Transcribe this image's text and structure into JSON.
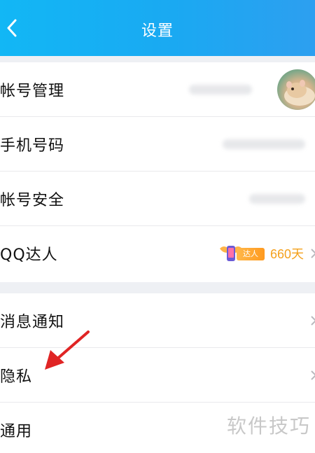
{
  "header": {
    "title": "设置",
    "back_icon": "chevron-left-icon"
  },
  "group1": {
    "rows": [
      {
        "label": "帐号管理"
      },
      {
        "label": "手机号码"
      },
      {
        "label": "帐号安全"
      },
      {
        "label": "QQ达人",
        "badge_text": "达人",
        "days": "660天"
      }
    ]
  },
  "group2": {
    "rows": [
      {
        "label": "消息通知"
      },
      {
        "label": "隐私"
      },
      {
        "label": "通用"
      }
    ]
  },
  "watermark": "软件技巧",
  "colors": {
    "header": "#12b7f5",
    "days": "#f4a11d",
    "annotation": "#e02424"
  }
}
